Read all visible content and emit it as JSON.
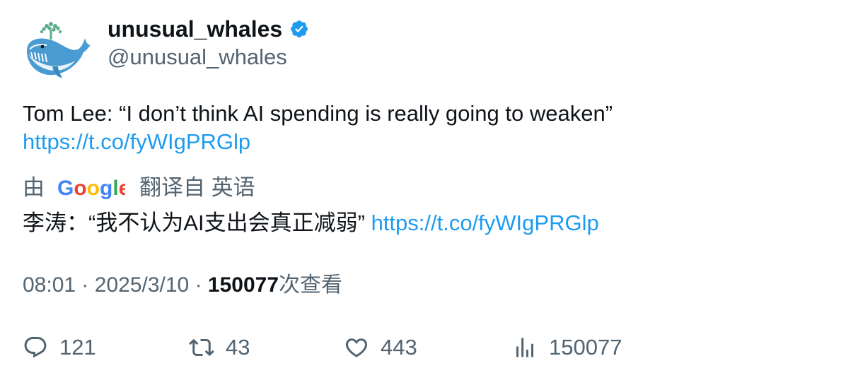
{
  "author": {
    "display_name": "unusual_whales",
    "handle": "@unusual_whales",
    "verified": true,
    "avatar_icon": "whale-logo-icon",
    "verified_icon": "verified-badge-icon"
  },
  "tweet": {
    "text": "Tom Lee: “I don’t think AI spending is really going to weaken”",
    "link": "https://t.co/fyWIgPRGlp"
  },
  "translation": {
    "prefix": "由",
    "provider_logo": "google-logo",
    "provider_name": "Google",
    "suffix": "翻译自 英语",
    "text": "李涛：“我不认为AI支出会真正减弱”",
    "link": "https://t.co/fyWIgPRGlp"
  },
  "meta": {
    "time": "08:01",
    "separator": "·",
    "date": "2025/3/10",
    "views_count": "150077",
    "views_label": "次查看"
  },
  "actions": {
    "reply": {
      "icon": "reply-icon",
      "count": "121"
    },
    "retweet": {
      "icon": "retweet-icon",
      "count": "43"
    },
    "like": {
      "icon": "heart-icon",
      "count": "443"
    },
    "views": {
      "icon": "bar-chart-icon",
      "count": "150077"
    }
  },
  "colors": {
    "link": "#1d9bf0",
    "secondary_text": "#536471",
    "primary_text": "#0f1419",
    "verified": "#1d9bf0"
  }
}
